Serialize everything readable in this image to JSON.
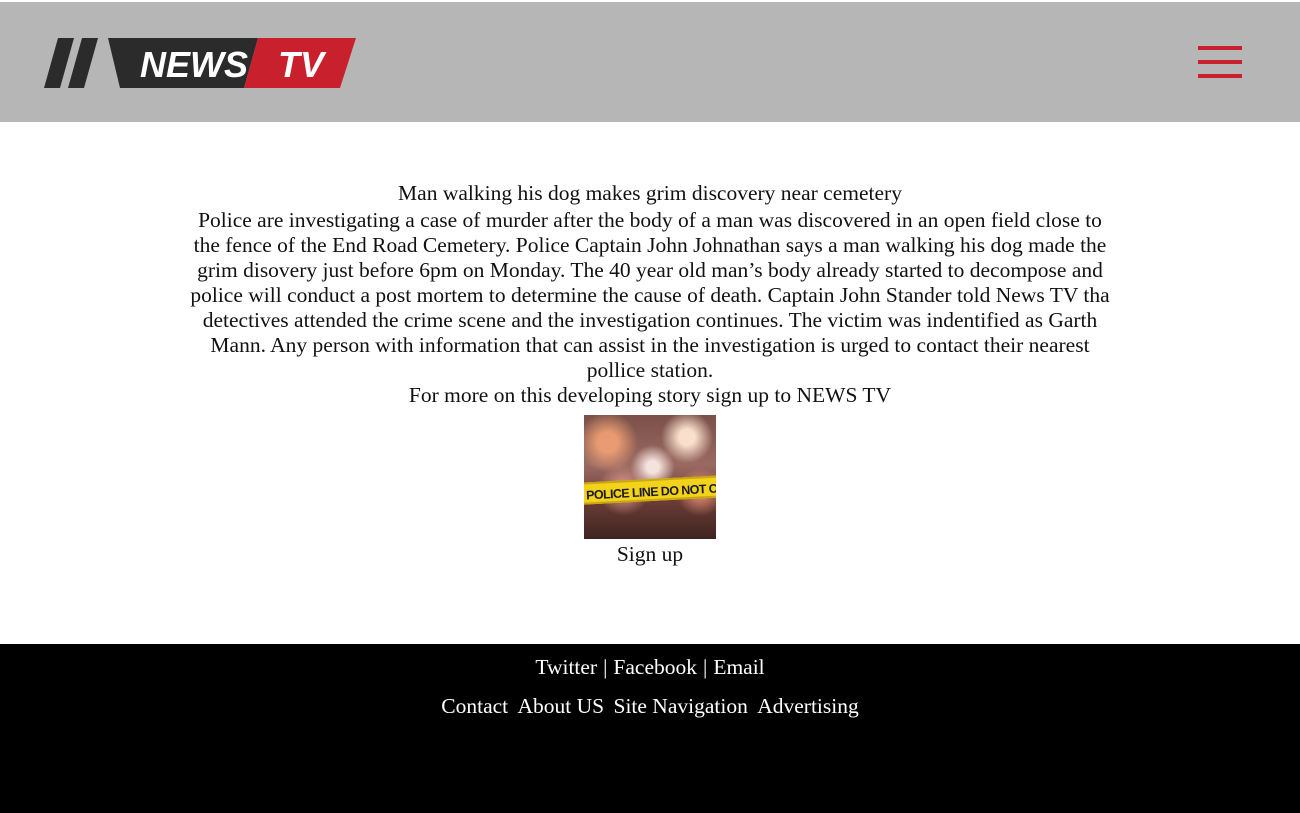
{
  "header": {
    "logo": {
      "text_news": "NEWS",
      "text_tv": "TV"
    },
    "menu_icon": "hamburger-menu-icon"
  },
  "article": {
    "headline": "Man walking his dog makes grim discovery near cemetery",
    "body": "Police are investigating a case of murder after the body of a man was discovered in an open field close to the fence of the End Road Cemetery. Police Captain John Johnathan says a man walking his dog made the grim disovery just before 6pm on Monday. The 40 year old man’s body already started to decompose and police will conduct a post mortem to determine the cause of death. Captain John Stander told News TV tha detectives attended the crime scene and the investigation continues. The victim was indentified as Garth Mann. Any person with information that can assist in the investigation is urged to contact their nearest pollice station.",
    "cta": "For more on this developing story sign up to NEWS TV",
    "image_tape_text": "POLICE LINE DO NOT CROSS",
    "signup_label": "Sign up"
  },
  "footer": {
    "social": [
      "Twitter",
      "Facebook",
      "Email"
    ],
    "separator": "|",
    "links": [
      "Contact",
      "About US",
      "Site Navigation",
      "Advertising"
    ]
  },
  "colors": {
    "header_bg": "#b6b6b6",
    "accent_red": "#c8202c",
    "logo_dark": "#2b2b2b",
    "footer_bg": "#000000"
  }
}
